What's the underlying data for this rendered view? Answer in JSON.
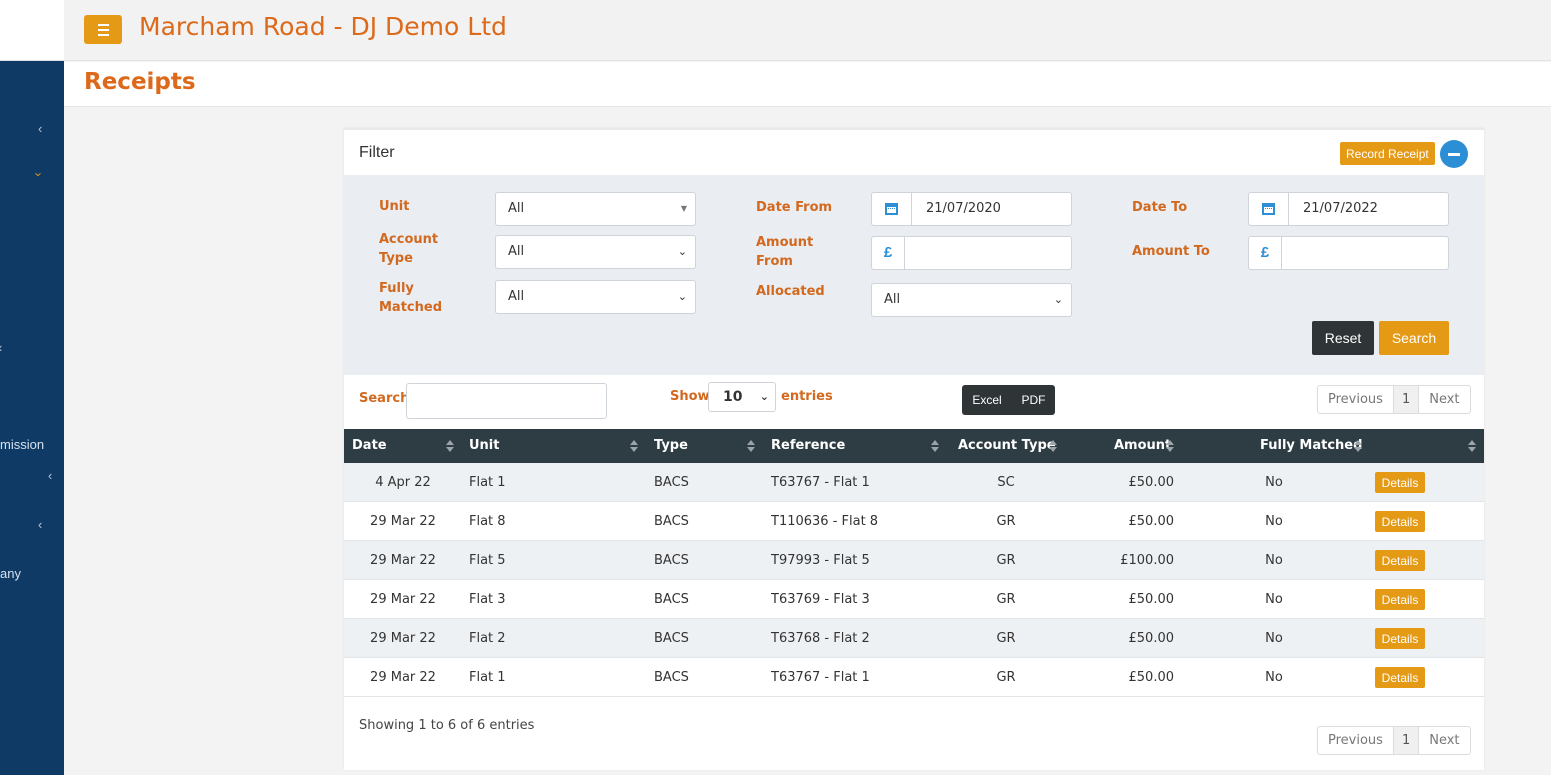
{
  "header": {
    "title": "Marcham Road - DJ Demo Ltd",
    "menu_icon": "hamburger-icon"
  },
  "sidebar": {
    "labels": [
      "mission",
      "any"
    ]
  },
  "page": {
    "title": "Receipts"
  },
  "filter": {
    "title": "Filter",
    "record_receipt": "Record Receipt",
    "unit_label": "Unit",
    "unit_value": "All",
    "account_type_label_1": "Account",
    "account_type_label_2": "Type",
    "account_type_value": "All",
    "fully_matched_label_1": "Fully",
    "fully_matched_label_2": "Matched",
    "fully_matched_value": "All",
    "date_from_label": "Date From",
    "date_from_value": "21/07/2020",
    "amount_from_label_1": "Amount",
    "amount_from_label_2": "From",
    "allocated_label": "Allocated",
    "allocated_value": "All",
    "date_to_label": "Date To",
    "date_to_value": "21/07/2022",
    "amount_to_label": "Amount To",
    "currency_symbol": "£",
    "reset": "Reset",
    "search": "Search"
  },
  "toolbar": {
    "search_label": "Search",
    "show_label": "Show",
    "entries_label": "entries",
    "length_value": "10",
    "excel": "Excel",
    "pdf": "PDF"
  },
  "pagination": {
    "previous": "Previous",
    "page": "1",
    "next": "Next"
  },
  "table": {
    "columns": [
      "Date",
      "Unit",
      "Type",
      "Reference",
      "Account Type",
      "Amount",
      "Fully Matched"
    ],
    "details_label": "Details",
    "rows": [
      {
        "date": "4 Apr 22",
        "unit": "Flat 1",
        "type": "BACS",
        "reference": "T63767 - Flat 1",
        "account_type": "SC",
        "amount": "£50.00",
        "fully_matched": "No"
      },
      {
        "date": "29 Mar 22",
        "unit": "Flat 8",
        "type": "BACS",
        "reference": "T110636 - Flat 8",
        "account_type": "GR",
        "amount": "£50.00",
        "fully_matched": "No"
      },
      {
        "date": "29 Mar 22",
        "unit": "Flat 5",
        "type": "BACS",
        "reference": "T97993 - Flat 5",
        "account_type": "GR",
        "amount": "£100.00",
        "fully_matched": "No"
      },
      {
        "date": "29 Mar 22",
        "unit": "Flat 3",
        "type": "BACS",
        "reference": "T63769 - Flat 3",
        "account_type": "GR",
        "amount": "£50.00",
        "fully_matched": "No"
      },
      {
        "date": "29 Mar 22",
        "unit": "Flat 2",
        "type": "BACS",
        "reference": "T63768 - Flat 2",
        "account_type": "GR",
        "amount": "£50.00",
        "fully_matched": "No"
      },
      {
        "date": "29 Mar 22",
        "unit": "Flat 1",
        "type": "BACS",
        "reference": "T63767 - Flat 1",
        "account_type": "GR",
        "amount": "£50.00",
        "fully_matched": "No"
      }
    ],
    "info": "Showing 1 to 6 of 6 entries"
  },
  "colors": {
    "accent": "#e59a16",
    "brand_text": "#dc6a1a",
    "sidebar": "#0f3a66",
    "table_header": "#2e3d44",
    "dark_button": "#2f3436",
    "icon_blue": "#2c8fd6"
  }
}
